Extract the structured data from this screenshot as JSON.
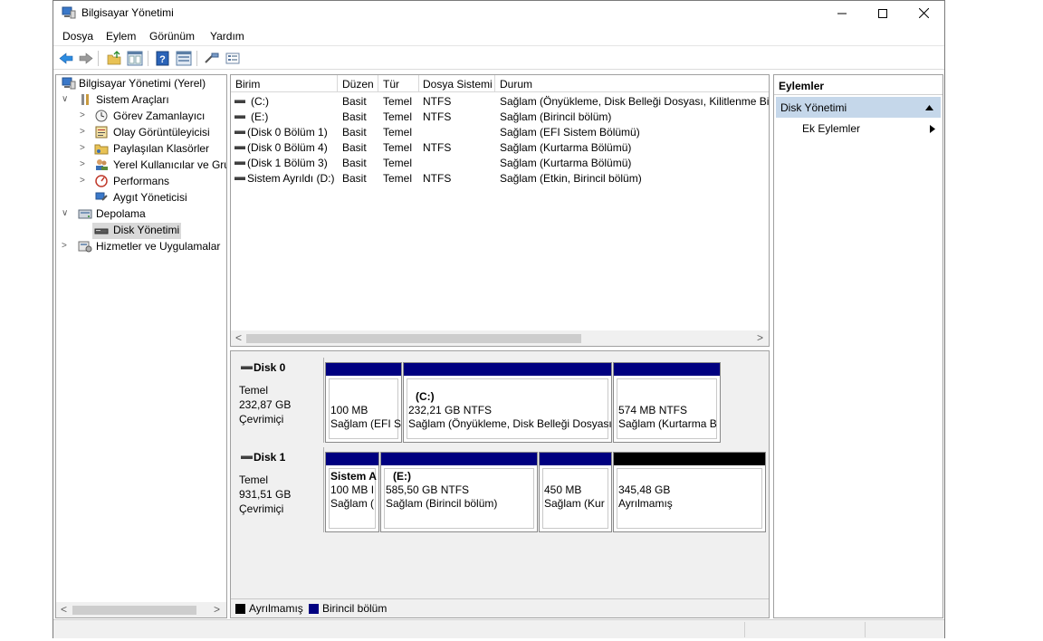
{
  "window": {
    "title": "Bilgisayar Yönetimi",
    "controls": [
      "minimize-icon",
      "maximize-icon",
      "close-icon"
    ]
  },
  "menu": [
    "Dosya",
    "Eylem",
    "Görünüm",
    "Yardım"
  ],
  "toolbar": [
    "back-arrow-icon",
    "forward-arrow-icon",
    "up-folder-icon",
    "show-hide-tree-icon",
    "help-icon",
    "properties-icon",
    "connect-icon",
    "list-view-icon"
  ],
  "tree": {
    "root": "Bilgisayar Yönetimi (Yerel)",
    "system_tools": "Sistem Araçları",
    "task_scheduler": "Görev Zamanlayıcı",
    "event_viewer": "Olay Görüntüleyicisi",
    "shared_folders": "Paylaşılan Klasörler",
    "local_users": "Yerel Kullanıcılar ve Gru",
    "performance": "Performans",
    "device_manager": "Aygıt Yöneticisi",
    "storage": "Depolama",
    "disk_management": "Disk Yönetimi",
    "services": "Hizmetler ve Uygulamalar"
  },
  "volume_list": {
    "columns": [
      "Birim",
      "Düzen",
      "Tür",
      "Dosya Sistemi",
      "Durum"
    ],
    "rows": [
      [
        "(C:)",
        "Basit",
        "Temel",
        "NTFS",
        "Sağlam (Önyükleme, Disk Belleği Dosyası, Kilitlenme Bilg"
      ],
      [
        "(E:)",
        "Basit",
        "Temel",
        "NTFS",
        "Sağlam (Birincil bölüm)"
      ],
      [
        "(Disk 0 Bölüm 1)",
        "Basit",
        "Temel",
        "",
        "Sağlam (EFI Sistem Bölümü)"
      ],
      [
        "(Disk 0 Bölüm 4)",
        "Basit",
        "Temel",
        "NTFS",
        "Sağlam (Kurtarma Bölümü)"
      ],
      [
        "(Disk 1 Bölüm 3)",
        "Basit",
        "Temel",
        "",
        "Sağlam (Kurtarma Bölümü)"
      ],
      [
        "Sistem Ayrıldı (D:)",
        "Basit",
        "Temel",
        "NTFS",
        "Sağlam (Etkin, Birincil bölüm)"
      ]
    ]
  },
  "disks": [
    {
      "name": "Disk 0",
      "type": "Temel",
      "size": "232,87 GB",
      "status": "Çevrimiçi",
      "partitions": [
        {
          "title": "",
          "size": "100 MB",
          "status": "Sağlam (EFI S",
          "kind": "primary"
        },
        {
          "title": "(C:)",
          "size": "232,21 GB NTFS",
          "status": "Sağlam (Önyükleme, Disk Belleği Dosyası",
          "kind": "primary"
        },
        {
          "title": "",
          "size": "574 MB NTFS",
          "status": "Sağlam (Kurtarma B",
          "kind": "primary"
        }
      ]
    },
    {
      "name": "Disk 1",
      "type": "Temel",
      "size": "931,51 GB",
      "status": "Çevrimiçi",
      "partitions": [
        {
          "title": "Sistem A",
          "size": "100 MB I",
          "status": "Sağlam (",
          "kind": "primary"
        },
        {
          "title": "(E:)",
          "size": "585,50 GB NTFS",
          "status": "Sağlam (Birincil bölüm)",
          "kind": "primary"
        },
        {
          "title": "",
          "size": "450 MB",
          "status": "Sağlam (Kur",
          "kind": "primary"
        },
        {
          "title": "",
          "size": "345,48 GB",
          "status": "Ayrılmamış",
          "kind": "unallocated"
        }
      ]
    }
  ],
  "legend": [
    {
      "label": "Ayrılmamış",
      "color": "#000000"
    },
    {
      "label": "Birincil bölüm",
      "color": "#000080"
    }
  ],
  "actions": {
    "header": "Eylemler",
    "section": "Disk Yönetimi",
    "more": "Ek Eylemler"
  },
  "colors": {
    "primary_bar": "#000080",
    "unallocated_bar": "#000000",
    "selection": "#c5d7ea"
  }
}
